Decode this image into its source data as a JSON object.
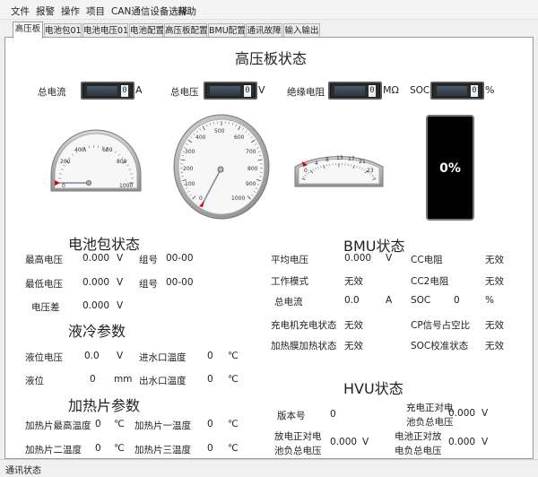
{
  "menu": [
    "文件",
    "报警",
    "操作",
    "项目",
    "CAN通信设备选择",
    "帮助"
  ],
  "tabs": [
    "高压板",
    "电池包01",
    "电池电压01",
    "电池配置",
    "高压板配置",
    "BMU配置",
    "通讯故障",
    "输入输出"
  ],
  "active_tab": 0,
  "hv": {
    "title": "高压板状态",
    "readouts": [
      {
        "label": "总电流",
        "digit": "0",
        "unit": "A"
      },
      {
        "label": "总电压",
        "digit": "0",
        "unit": "V"
      },
      {
        "label": "绝缘电阻",
        "digit": "0",
        "unit": "MΩ"
      },
      {
        "label": "SOC",
        "digit": "0",
        "unit": "%"
      }
    ],
    "gauge1": {
      "ticks": [
        "0",
        "200",
        "400",
        "600",
        "800",
        "1000"
      ],
      "value": 0
    },
    "gauge2": {
      "ticks": [
        "0",
        "100",
        "200",
        "300",
        "400",
        "500",
        "600",
        "700",
        "800",
        "900",
        "1000"
      ],
      "value": 0
    },
    "gauge3": {
      "ticks": [
        "0",
        "4",
        "8",
        "13",
        "17",
        "21",
        "23"
      ],
      "value": 0
    },
    "soc_display": "0%"
  },
  "battery": {
    "title": "电池包状态",
    "max_v_label": "最高电压",
    "max_v": "0.000",
    "max_v_unit": "V",
    "max_group_label": "组号",
    "max_group": "00-00",
    "min_v_label": "最低电压",
    "min_v": "0.000",
    "min_v_unit": "V",
    "min_group_label": "组号",
    "min_group": "00-00",
    "diff_label": "电压差",
    "diff": "0.000",
    "diff_unit": "V"
  },
  "cooling": {
    "title": "液冷参数",
    "level_v_label": "液位电压",
    "level_v": "0.0",
    "level_v_unit": "V",
    "inlet_label": "进水口温度",
    "inlet": "0",
    "inlet_unit": "℃",
    "level_label": "液位",
    "level": "0",
    "level_unit": "mm",
    "outlet_label": "出水口温度",
    "outlet": "0",
    "outlet_unit": "℃"
  },
  "heater": {
    "title": "加热片参数",
    "max_label": "加热片最高温度",
    "max": "0",
    "max_unit": "℃",
    "h1_label": "加热片一温度",
    "h1": "0",
    "h1_unit": "℃",
    "h2_label": "加热片二温度",
    "h2": "0",
    "h2_unit": "℃",
    "h3_label": "加热片三温度",
    "h3": "0",
    "h3_unit": "℃"
  },
  "bmu": {
    "title": "BMU状态",
    "avg_v_label": "平均电压",
    "avg_v": "0.000",
    "avg_v_unit": "V",
    "cc_label": "CC电阻",
    "cc": "无效",
    "mode_label": "工作模式",
    "mode": "无效",
    "cc2_label": "CC2电阻",
    "cc2": "无效",
    "current_label": "总电流",
    "current": "0.0",
    "current_unit": "A",
    "soc_label": "SOC",
    "soc": "0",
    "soc_unit": "%",
    "charger_label": "充电机充电状态",
    "charger": "无效",
    "cp_label": "CP信号占空比",
    "cp": "无效",
    "heat_relay_label": "加热膜加热状态",
    "heat_relay": "无效",
    "soc_cal_label": "SOC校准状态",
    "soc_cal": "无效"
  },
  "hvu": {
    "title": "HVU状态",
    "version_label": "版本号",
    "version": "0",
    "pos_neg_label_1": "充电正对电",
    "pos_neg_label_2": "池负总电压",
    "pos_neg": "0.000",
    "pos_neg_unit": "V",
    "dis_label_1": "放电正对电",
    "dis_label_2": "池负总电压",
    "dis": "0.000",
    "dis_unit": "V",
    "pos_dis_label_1": "电池正对放",
    "pos_dis_label_2": "电负总电压",
    "pos_dis": "0.000",
    "pos_dis_unit": "V"
  },
  "status_bar": "通讯状态"
}
